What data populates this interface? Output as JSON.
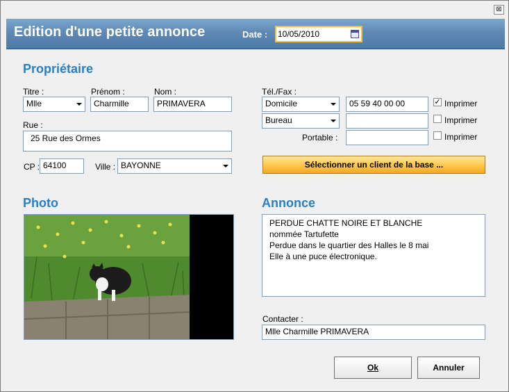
{
  "window": {
    "close_glyph": "⊠"
  },
  "header": {
    "title": "Edition d'une petite annonce",
    "date_label": "Date :",
    "date_value": "10/05/2010",
    "calendar_icon": "calendar-icon"
  },
  "owner": {
    "section_title": "Propriétaire",
    "titre_label": "Titre :",
    "titre_value": "Mlle",
    "prenom_label": "Prénom :",
    "prenom_value": "Charmille",
    "nom_label": "Nom :",
    "nom_value": "PRIMAVERA",
    "rue_label": "Rue :",
    "rue_value": "25 Rue des Ormes",
    "cp_label": "CP :",
    "cp_value": "64100",
    "ville_label": "Ville :",
    "ville_value": "BAYONNE"
  },
  "phone": {
    "label": "Tél./Fax :",
    "rows": [
      {
        "type": "Domicile",
        "number": "05 59 40 00 00",
        "print_label": "Imprimer",
        "print_checked": true
      },
      {
        "type": "Bureau",
        "number": "",
        "print_label": "Imprimer",
        "print_checked": false
      }
    ],
    "portable_label": "Portable :",
    "portable_value": "",
    "portable_print_label": "Imprimer",
    "portable_print_checked": false
  },
  "select_client_button": "Sélectionner un client de la base ...",
  "photo": {
    "section_title": "Photo"
  },
  "annonce": {
    "section_title": "Annonce",
    "lines": [
      "PERDUE CHATTE NOIRE ET BLANCHE",
      "nommée Tartufette",
      "Perdue dans le quartier des Halles le 8 mai",
      "Elle à une puce électronique."
    ],
    "contact_label": "Contacter :",
    "contact_value": "Mlle Charmille PRIMAVERA"
  },
  "buttons": {
    "ok": "Ok",
    "cancel": "Annuler"
  },
  "colors": {
    "section_title": "#2a7fc2",
    "header_bg": "#5f8ab5",
    "date_border": "#f0c040"
  }
}
